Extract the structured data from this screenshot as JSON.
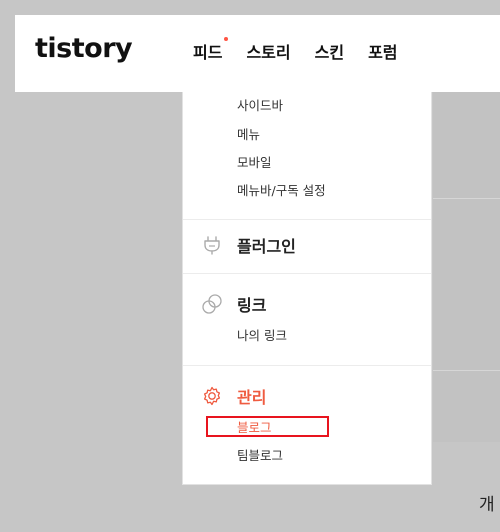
{
  "header": {
    "logo": "tistory",
    "nav": [
      "피드",
      "스토리",
      "스킨",
      "포럼"
    ],
    "nav_dot_color": "#ff5544"
  },
  "menu": {
    "design_sub": [
      "사이드바",
      "메뉴",
      "모바일",
      "메뉴바/구독 설정"
    ],
    "plugin": {
      "title": "플러그인",
      "icon": "plug-icon"
    },
    "link": {
      "title": "링크",
      "icon": "link-icon",
      "items": [
        "나의 링크"
      ]
    },
    "manage": {
      "title": "관리",
      "icon": "gear-icon",
      "items": [
        "블로그",
        "팀블로그"
      ]
    },
    "accent_color": "#ef5b40",
    "highlight_color": "#e8141e"
  },
  "footer": {
    "partial_text": "개"
  }
}
